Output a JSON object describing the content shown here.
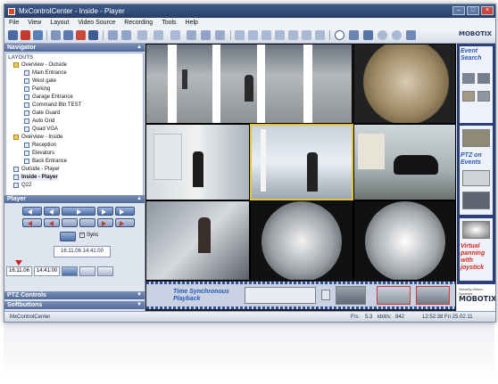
{
  "window": {
    "title": "MxControlCenter - Inside - Player"
  },
  "menu": [
    "File",
    "View",
    "Layout",
    "Video Source",
    "Recording",
    "Tools",
    "Help"
  ],
  "brand": "MOBOTIX",
  "navigator": {
    "title": "Navigator",
    "section": "LAYOUTS",
    "items": [
      {
        "label": "Overview - Outside",
        "level": 1,
        "type": "folder"
      },
      {
        "label": "Main Entrance",
        "level": 2,
        "type": "view"
      },
      {
        "label": "West gate",
        "level": 2,
        "type": "view"
      },
      {
        "label": "Parking",
        "level": 2,
        "type": "view"
      },
      {
        "label": "Garage Entrance",
        "level": 2,
        "type": "view"
      },
      {
        "label": "Command Btn TEST",
        "level": 2,
        "type": "view"
      },
      {
        "label": "Gate Guard",
        "level": 2,
        "type": "view"
      },
      {
        "label": "Auto Grid",
        "level": 2,
        "type": "view"
      },
      {
        "label": "Quad VGA",
        "level": 2,
        "type": "view"
      },
      {
        "label": "Overview - Inside",
        "level": 1,
        "type": "folder"
      },
      {
        "label": "Reception",
        "level": 2,
        "type": "view"
      },
      {
        "label": "Elevators",
        "level": 2,
        "type": "view"
      },
      {
        "label": "Back Entrance",
        "level": 2,
        "type": "view"
      },
      {
        "label": "Outside - Player",
        "level": 1,
        "type": "view"
      },
      {
        "label": "Inside - Player",
        "level": 1,
        "type": "view",
        "selected": true
      },
      {
        "label": "Q22",
        "level": 1,
        "type": "view"
      }
    ]
  },
  "player": {
    "title": "Player",
    "sync_label": "Sync",
    "datetime": "16.11.06 14:41:00",
    "date_field": "16.11.06",
    "time_field": "14:41:00"
  },
  "panels": {
    "ptz": "PTZ Controls",
    "softbuttons": "Softbuttons"
  },
  "overlays": {
    "time_sync": "Time Synchronous Playback",
    "event_search": "Event Search",
    "ptz_on_events": "PTZ on Events",
    "virtual_pan": "Virtual panning with joystick",
    "security_vision": "Security-Vision-Systems",
    "mobotix": "MOBOTIX"
  },
  "status": {
    "app": "MxControlCenter",
    "fps_label": "F/s:",
    "fps": "5.3",
    "kbps_label": "kbit/s:",
    "kbps": "842",
    "clock": "12:52:38 Fri 25.02.11"
  },
  "colors": {
    "accent": "#2b4a83",
    "highlight": "#e4c43a",
    "annotation": "#2956b9"
  }
}
